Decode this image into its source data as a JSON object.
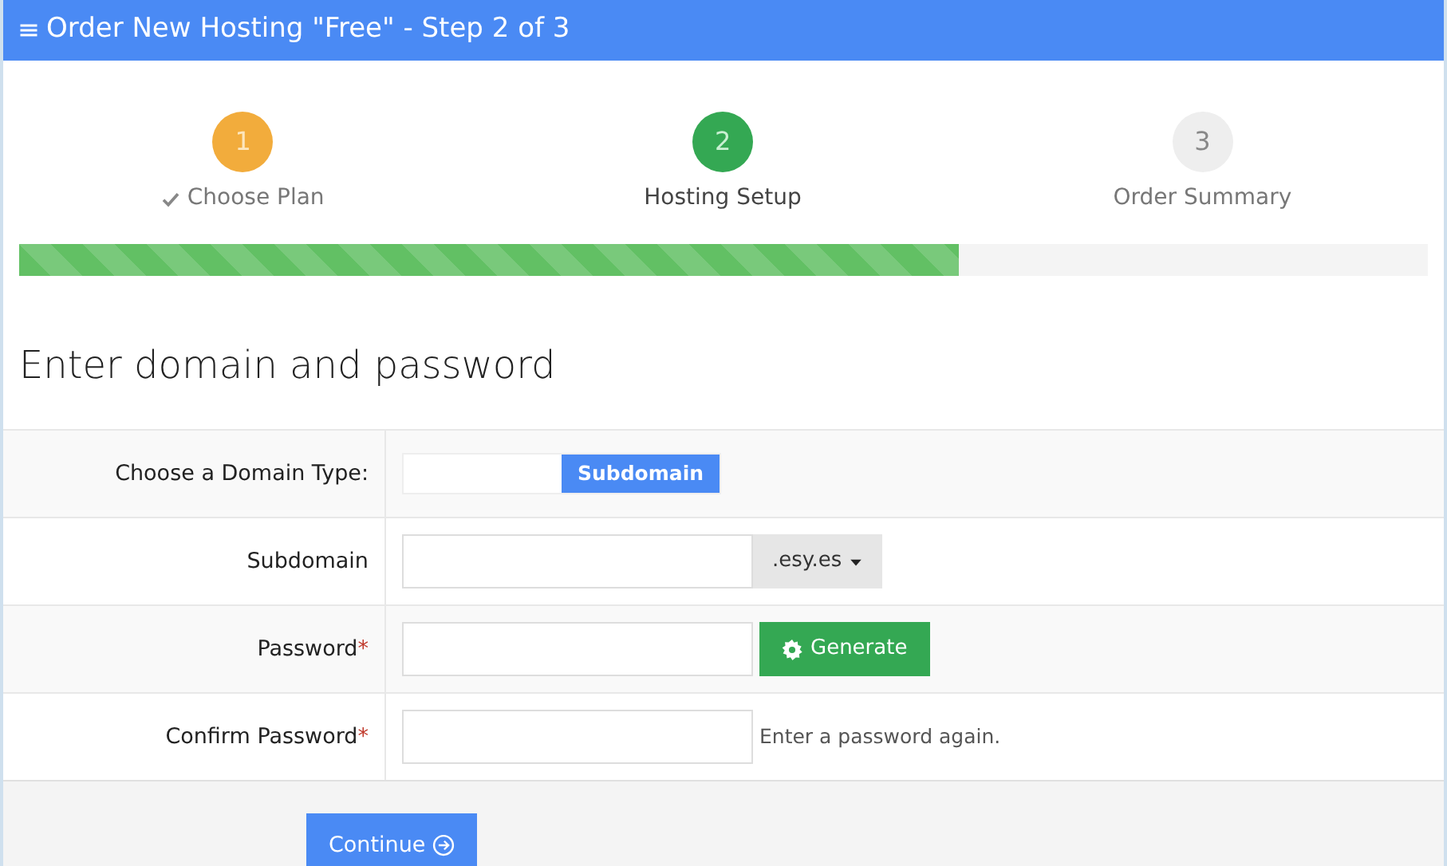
{
  "header": {
    "title": "Order New Hosting \"Free\" - Step 2 of 3"
  },
  "steps": [
    {
      "number": "1",
      "label": "Choose Plan",
      "kind": "done"
    },
    {
      "number": "2",
      "label": "Hosting Setup",
      "kind": "current"
    },
    {
      "number": "3",
      "label": "Order Summary",
      "kind": "pending"
    }
  ],
  "progress": {
    "level": 0.667
  },
  "heading": "Enter domain and password",
  "form": [
    {
      "kind": "toggle",
      "label": "Choose a Domain Type:",
      "options": [
        {
          "label": "Subdomain",
          "selected": true
        }
      ]
    },
    {
      "kind": "addon",
      "label": "Subdomain",
      "addon": ".esy.es"
    },
    {
      "kind": "generate",
      "label": "Password",
      "required_mark": "*",
      "button": "Generate"
    },
    {
      "kind": "hint",
      "label": "Confirm Password",
      "required_mark": "*",
      "hint": "Enter a password again."
    }
  ],
  "continue_button": "Continue"
}
